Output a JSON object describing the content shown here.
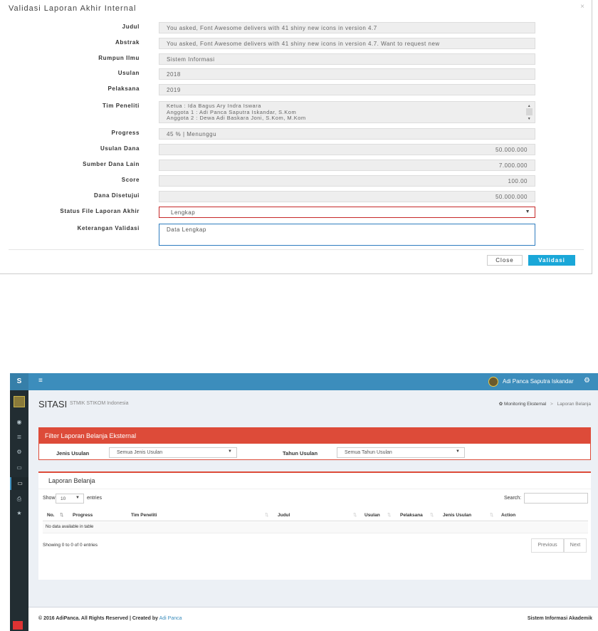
{
  "modal": {
    "title": "Validasi Laporan Akhir Internal",
    "close_x": "×",
    "fields": {
      "judul": {
        "label": "Judul",
        "value": "You asked, Font Awesome delivers with 41 shiny new icons in version 4.7"
      },
      "abstrak": {
        "label": "Abstrak",
        "value": "You asked, Font Awesome delivers with 41 shiny new icons in version 4.7. Want to request new"
      },
      "rumpun_ilmu": {
        "label": "Rumpun Ilmu",
        "value": "Sistem Informasi"
      },
      "usulan": {
        "label": "Usulan",
        "value": "2018"
      },
      "pelaksana": {
        "label": "Pelaksana",
        "value": "2019"
      },
      "tim_peneliti": {
        "label": "Tim Peneliti",
        "lines": [
          "Ketua : Ida Bagus Ary Indra Iswara",
          "Anggota 1 : Adi Panca Saputra Iskandar, S.Kom",
          "Anggota 2 : Dewa Adi Baskara Joni, S.Kom, M.Kom"
        ]
      },
      "progress": {
        "label": "Progress",
        "value": "45 %  |  Menunggu"
      },
      "usulan_dana": {
        "label": "Usulan Dana",
        "value": "50.000.000"
      },
      "sumber_dana_lain": {
        "label": "Sumber Dana Lain",
        "value": "7.000.000"
      },
      "score": {
        "label": "Score",
        "value": "100.00"
      },
      "dana_disetujui": {
        "label": "Dana Disetujui",
        "value": "50.000.000"
      },
      "status_file": {
        "label": "Status File Laporan Akhir",
        "value": "Lengkap"
      },
      "keterangan": {
        "label": "Keterangan Validasi",
        "value": "Data Lengkap"
      }
    },
    "buttons": {
      "close": "Close",
      "validasi": "Validasi"
    },
    "colors": {
      "primary": "#1aa7d8",
      "error_border": "#c62828",
      "focus_border": "#2f7dbf"
    }
  },
  "app": {
    "logo_letter": "S",
    "user_name": "Adi Panca Saputra Iskandar",
    "page_title": "SITASI",
    "page_subtitle": "STMIK STIKOM Indonesia",
    "breadcrumb": {
      "root": "Monitoring Eksternal",
      "separator": ">",
      "current": "Laporan Belanja"
    },
    "sidebar_icons": [
      "dashboard-icon",
      "database-icon",
      "cogs-icon",
      "desktop-icon",
      "desktop-icon",
      "print-icon",
      "star-icon"
    ],
    "filter": {
      "title": "Filter Laporan Belanja Eksternal",
      "jenis_label": "Jenis Usulan",
      "jenis_value": "Semua Jenis Usulan",
      "tahun_label": "Tahun Usulan",
      "tahun_value": "Semua Tahun Usulan"
    },
    "table": {
      "title": "Laporan Belanja",
      "show_label": "Show",
      "length_value": "10",
      "entries_label": "entries",
      "search_label": "Search:",
      "columns": [
        "No.",
        "Progress",
        "Tim Peneliti",
        "Judul",
        "Usulan",
        "Pelaksana",
        "Jenis Usulan",
        "Action"
      ],
      "empty_text": "No data available in table",
      "info": "Showing 0 to 0 of 0 entries",
      "previous": "Previous",
      "next": "Next"
    },
    "footer": {
      "copyright": "© 2016 AdiPanca. All Rights Reserved | Created by",
      "author": "Adi Panca",
      "right": "Sistem Informasi Akademik"
    },
    "colors": {
      "header": "#3c8dbc",
      "sidebar": "#222d32",
      "danger": "#dd4b39"
    }
  }
}
